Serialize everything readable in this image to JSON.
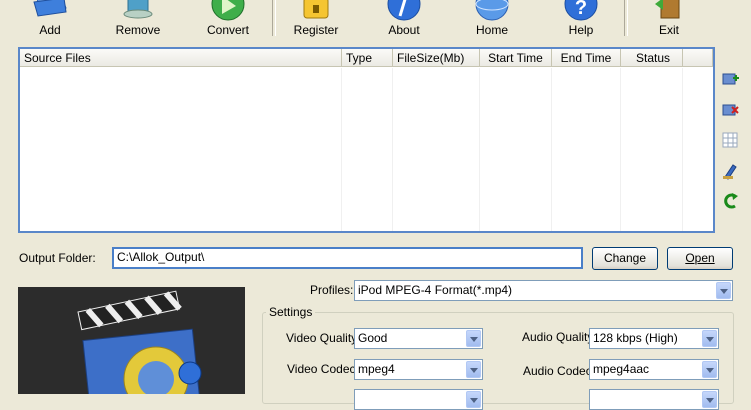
{
  "toolbar": {
    "add": "Add",
    "remove": "Remove",
    "convert": "Convert",
    "register": "Register",
    "about": "About",
    "home": "Home",
    "help": "Help",
    "exit": "Exit"
  },
  "file_list": {
    "columns": [
      "Source Files",
      "Type",
      "FileSize(Mb)",
      "Start Time",
      "End Time",
      "Status"
    ],
    "rows": []
  },
  "output": {
    "label": "Output Folder:",
    "path": "C:\\Allok_Output\\",
    "change": "Change",
    "open": "Open"
  },
  "profiles": {
    "label": "Profiles:",
    "value": "iPod MPEG-4 Format(*.mp4)"
  },
  "settings": {
    "title": "Settings",
    "video_quality_label": "Video Quality:",
    "video_quality": "Good",
    "audio_quality_label": "Audio Quality:",
    "audio_quality": "128 kbps (High)",
    "video_codec_label": "Video Codec:",
    "video_codec": "mpeg4",
    "audio_codec_label": "Audio Codec:",
    "audio_codec": "mpeg4aac"
  },
  "colors": {
    "window_bg": "#ece9d8",
    "list_border": "#5a87c9",
    "output_path_border": "#4a7fc8"
  }
}
